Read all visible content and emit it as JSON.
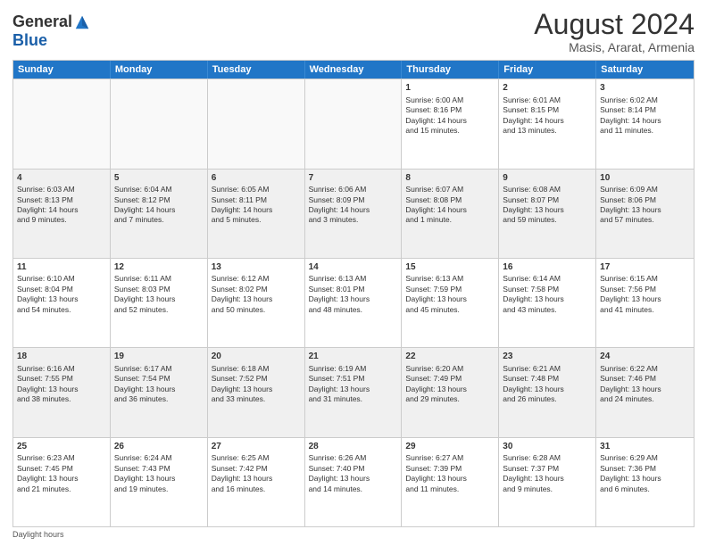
{
  "logo": {
    "general": "General",
    "blue": "Blue"
  },
  "title": "August 2024",
  "subtitle": "Masis, Ararat, Armenia",
  "days": [
    "Sunday",
    "Monday",
    "Tuesday",
    "Wednesday",
    "Thursday",
    "Friday",
    "Saturday"
  ],
  "footer": "Daylight hours",
  "weeks": [
    [
      {
        "day": "",
        "info": ""
      },
      {
        "day": "",
        "info": ""
      },
      {
        "day": "",
        "info": ""
      },
      {
        "day": "",
        "info": ""
      },
      {
        "day": "1",
        "info": "Sunrise: 6:00 AM\nSunset: 8:16 PM\nDaylight: 14 hours\nand 15 minutes."
      },
      {
        "day": "2",
        "info": "Sunrise: 6:01 AM\nSunset: 8:15 PM\nDaylight: 14 hours\nand 13 minutes."
      },
      {
        "day": "3",
        "info": "Sunrise: 6:02 AM\nSunset: 8:14 PM\nDaylight: 14 hours\nand 11 minutes."
      }
    ],
    [
      {
        "day": "4",
        "info": "Sunrise: 6:03 AM\nSunset: 8:13 PM\nDaylight: 14 hours\nand 9 minutes."
      },
      {
        "day": "5",
        "info": "Sunrise: 6:04 AM\nSunset: 8:12 PM\nDaylight: 14 hours\nand 7 minutes."
      },
      {
        "day": "6",
        "info": "Sunrise: 6:05 AM\nSunset: 8:11 PM\nDaylight: 14 hours\nand 5 minutes."
      },
      {
        "day": "7",
        "info": "Sunrise: 6:06 AM\nSunset: 8:09 PM\nDaylight: 14 hours\nand 3 minutes."
      },
      {
        "day": "8",
        "info": "Sunrise: 6:07 AM\nSunset: 8:08 PM\nDaylight: 14 hours\nand 1 minute."
      },
      {
        "day": "9",
        "info": "Sunrise: 6:08 AM\nSunset: 8:07 PM\nDaylight: 13 hours\nand 59 minutes."
      },
      {
        "day": "10",
        "info": "Sunrise: 6:09 AM\nSunset: 8:06 PM\nDaylight: 13 hours\nand 57 minutes."
      }
    ],
    [
      {
        "day": "11",
        "info": "Sunrise: 6:10 AM\nSunset: 8:04 PM\nDaylight: 13 hours\nand 54 minutes."
      },
      {
        "day": "12",
        "info": "Sunrise: 6:11 AM\nSunset: 8:03 PM\nDaylight: 13 hours\nand 52 minutes."
      },
      {
        "day": "13",
        "info": "Sunrise: 6:12 AM\nSunset: 8:02 PM\nDaylight: 13 hours\nand 50 minutes."
      },
      {
        "day": "14",
        "info": "Sunrise: 6:13 AM\nSunset: 8:01 PM\nDaylight: 13 hours\nand 48 minutes."
      },
      {
        "day": "15",
        "info": "Sunrise: 6:13 AM\nSunset: 7:59 PM\nDaylight: 13 hours\nand 45 minutes."
      },
      {
        "day": "16",
        "info": "Sunrise: 6:14 AM\nSunset: 7:58 PM\nDaylight: 13 hours\nand 43 minutes."
      },
      {
        "day": "17",
        "info": "Sunrise: 6:15 AM\nSunset: 7:56 PM\nDaylight: 13 hours\nand 41 minutes."
      }
    ],
    [
      {
        "day": "18",
        "info": "Sunrise: 6:16 AM\nSunset: 7:55 PM\nDaylight: 13 hours\nand 38 minutes."
      },
      {
        "day": "19",
        "info": "Sunrise: 6:17 AM\nSunset: 7:54 PM\nDaylight: 13 hours\nand 36 minutes."
      },
      {
        "day": "20",
        "info": "Sunrise: 6:18 AM\nSunset: 7:52 PM\nDaylight: 13 hours\nand 33 minutes."
      },
      {
        "day": "21",
        "info": "Sunrise: 6:19 AM\nSunset: 7:51 PM\nDaylight: 13 hours\nand 31 minutes."
      },
      {
        "day": "22",
        "info": "Sunrise: 6:20 AM\nSunset: 7:49 PM\nDaylight: 13 hours\nand 29 minutes."
      },
      {
        "day": "23",
        "info": "Sunrise: 6:21 AM\nSunset: 7:48 PM\nDaylight: 13 hours\nand 26 minutes."
      },
      {
        "day": "24",
        "info": "Sunrise: 6:22 AM\nSunset: 7:46 PM\nDaylight: 13 hours\nand 24 minutes."
      }
    ],
    [
      {
        "day": "25",
        "info": "Sunrise: 6:23 AM\nSunset: 7:45 PM\nDaylight: 13 hours\nand 21 minutes."
      },
      {
        "day": "26",
        "info": "Sunrise: 6:24 AM\nSunset: 7:43 PM\nDaylight: 13 hours\nand 19 minutes."
      },
      {
        "day": "27",
        "info": "Sunrise: 6:25 AM\nSunset: 7:42 PM\nDaylight: 13 hours\nand 16 minutes."
      },
      {
        "day": "28",
        "info": "Sunrise: 6:26 AM\nSunset: 7:40 PM\nDaylight: 13 hours\nand 14 minutes."
      },
      {
        "day": "29",
        "info": "Sunrise: 6:27 AM\nSunset: 7:39 PM\nDaylight: 13 hours\nand 11 minutes."
      },
      {
        "day": "30",
        "info": "Sunrise: 6:28 AM\nSunset: 7:37 PM\nDaylight: 13 hours\nand 9 minutes."
      },
      {
        "day": "31",
        "info": "Sunrise: 6:29 AM\nSunset: 7:36 PM\nDaylight: 13 hours\nand 6 minutes."
      }
    ]
  ]
}
